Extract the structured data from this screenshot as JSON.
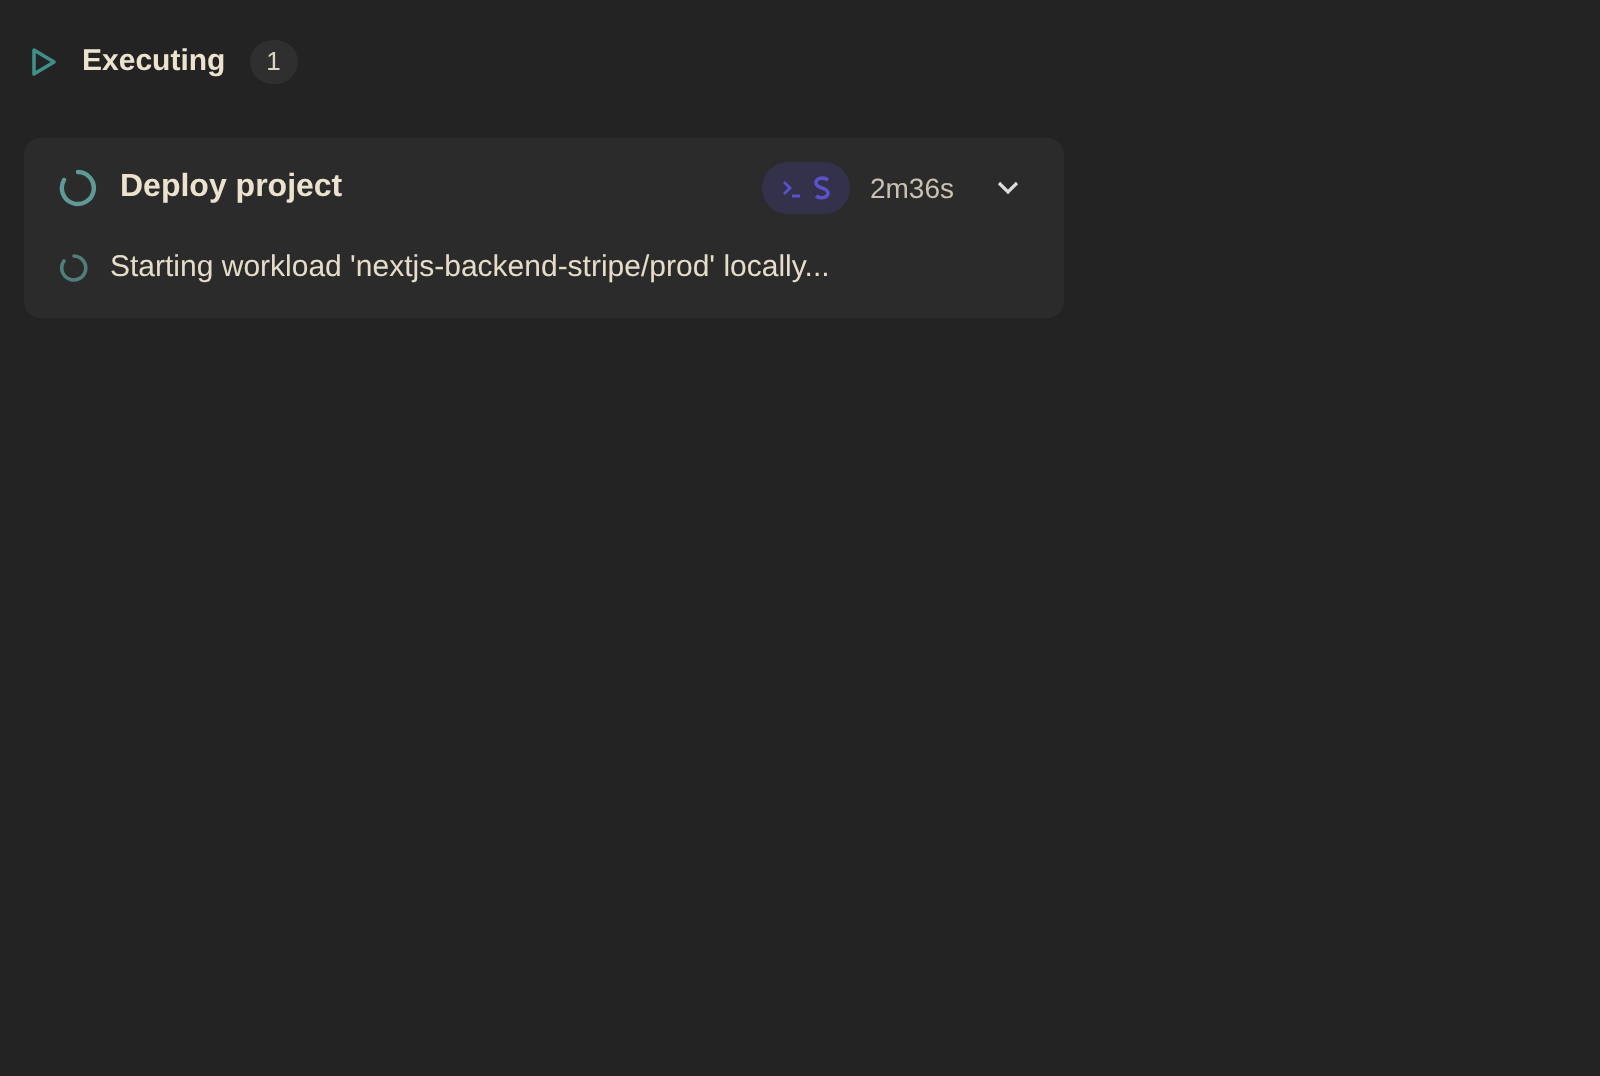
{
  "section": {
    "title": "Executing",
    "count": "1"
  },
  "tasks": [
    {
      "title": "Deploy project",
      "duration": "2m36s",
      "steps": [
        "Starting workload 'nextjs-backend-stripe/prod' locally..."
      ]
    }
  ]
}
